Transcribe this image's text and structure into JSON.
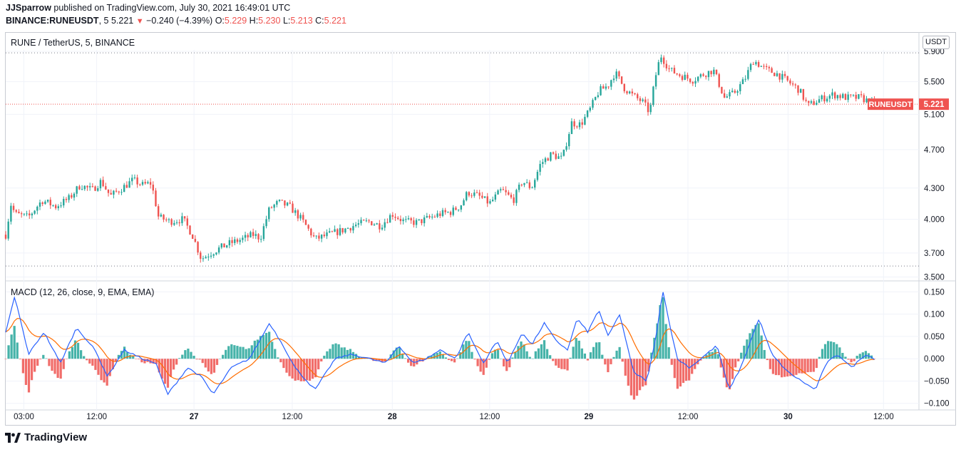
{
  "header": {
    "user": "JJSparrow",
    "published": "published on TradingView.com, July 30, 2021 16:49:01 UTC",
    "symbol": "BINANCE:RUNEUSDT",
    "interval": "5",
    "last": "5.221",
    "change": "−0.240 (−4.39%)",
    "o_label": "O:",
    "o": "5.229",
    "h_label": "H:",
    "h": "5.230",
    "l_label": "L:",
    "l": "5.213",
    "c_label": "C:",
    "c": "5.221"
  },
  "price_pane": {
    "title": "RUNE / TetherUS, 5, BINANCE",
    "currency": "USDT",
    "price_label_symbol": "RUNEUSDT",
    "price_label_value": "5.221"
  },
  "macd_pane": {
    "title": "MACD (12, 26, close, 9, EMA, EMA)"
  },
  "footer": {
    "brand": "TradingView"
  },
  "colors": {
    "up": "#26a69a",
    "down": "#ef5350",
    "macd": "#2962ff",
    "signal": "#ff6d00",
    "price_line": "#ef5350"
  },
  "chart_data": [
    {
      "type": "candlestick",
      "title": "RUNE / TetherUS, 5, BINANCE",
      "y_axis_ticks": [
        "3.500",
        "3.700",
        "4.000",
        "4.300",
        "4.700",
        "5.100",
        "5.500",
        "5.900"
      ],
      "y_axis_scale": "log",
      "ylim": [
        3.48,
        5.92
      ],
      "x_axis_ticks": [
        "03:00",
        "12:00",
        "27",
        "12:00",
        "28",
        "12:00",
        "29",
        "12:00",
        "30",
        "12:00"
      ],
      "last_price": 5.221,
      "dotted_levels": [
        5.88,
        3.59
      ],
      "close_path": [
        {
          "t": 0.0,
          "p": 3.86
        },
        {
          "t": 0.006,
          "p": 4.15
        },
        {
          "t": 0.01,
          "p": 4.05
        },
        {
          "t": 0.025,
          "p": 4.02
        },
        {
          "t": 0.04,
          "p": 4.18
        },
        {
          "t": 0.055,
          "p": 4.12
        },
        {
          "t": 0.07,
          "p": 4.2
        },
        {
          "t": 0.082,
          "p": 4.33
        },
        {
          "t": 0.095,
          "p": 4.28
        },
        {
          "t": 0.105,
          "p": 4.37
        },
        {
          "t": 0.115,
          "p": 4.22
        },
        {
          "t": 0.128,
          "p": 4.3
        },
        {
          "t": 0.14,
          "p": 4.38
        },
        {
          "t": 0.15,
          "p": 4.33
        },
        {
          "t": 0.16,
          "p": 4.35
        },
        {
          "t": 0.168,
          "p": 4.02
        },
        {
          "t": 0.18,
          "p": 3.98
        },
        {
          "t": 0.195,
          "p": 4.0
        },
        {
          "t": 0.205,
          "p": 3.86
        },
        {
          "t": 0.215,
          "p": 3.65
        },
        {
          "t": 0.23,
          "p": 3.72
        },
        {
          "t": 0.245,
          "p": 3.78
        },
        {
          "t": 0.26,
          "p": 3.82
        },
        {
          "t": 0.272,
          "p": 3.86
        },
        {
          "t": 0.28,
          "p": 3.83
        },
        {
          "t": 0.29,
          "p": 4.1
        },
        {
          "t": 0.3,
          "p": 4.16
        },
        {
          "t": 0.312,
          "p": 4.12
        },
        {
          "t": 0.325,
          "p": 4.0
        },
        {
          "t": 0.34,
          "p": 3.82
        },
        {
          "t": 0.355,
          "p": 3.86
        },
        {
          "t": 0.37,
          "p": 3.9
        },
        {
          "t": 0.385,
          "p": 3.95
        },
        {
          "t": 0.4,
          "p": 3.98
        },
        {
          "t": 0.412,
          "p": 3.94
        },
        {
          "t": 0.425,
          "p": 4.05
        },
        {
          "t": 0.438,
          "p": 3.98
        },
        {
          "t": 0.452,
          "p": 3.97
        },
        {
          "t": 0.465,
          "p": 4.01
        },
        {
          "t": 0.478,
          "p": 4.05
        },
        {
          "t": 0.49,
          "p": 4.07
        },
        {
          "t": 0.5,
          "p": 4.13
        },
        {
          "t": 0.508,
          "p": 4.26
        },
        {
          "t": 0.52,
          "p": 4.22
        },
        {
          "t": 0.532,
          "p": 4.15
        },
        {
          "t": 0.545,
          "p": 4.28
        },
        {
          "t": 0.558,
          "p": 4.18
        },
        {
          "t": 0.568,
          "p": 4.37
        },
        {
          "t": 0.578,
          "p": 4.3
        },
        {
          "t": 0.588,
          "p": 4.55
        },
        {
          "t": 0.6,
          "p": 4.65
        },
        {
          "t": 0.612,
          "p": 4.6
        },
        {
          "t": 0.622,
          "p": 5.0
        },
        {
          "t": 0.632,
          "p": 4.98
        },
        {
          "t": 0.642,
          "p": 5.15
        },
        {
          "t": 0.652,
          "p": 5.38
        },
        {
          "t": 0.662,
          "p": 5.45
        },
        {
          "t": 0.67,
          "p": 5.62
        },
        {
          "t": 0.68,
          "p": 5.42
        },
        {
          "t": 0.69,
          "p": 5.32
        },
        {
          "t": 0.7,
          "p": 5.25
        },
        {
          "t": 0.708,
          "p": 5.12
        },
        {
          "t": 0.714,
          "p": 5.55
        },
        {
          "t": 0.72,
          "p": 5.85
        },
        {
          "t": 0.73,
          "p": 5.65
        },
        {
          "t": 0.742,
          "p": 5.58
        },
        {
          "t": 0.755,
          "p": 5.52
        },
        {
          "t": 0.768,
          "p": 5.6
        },
        {
          "t": 0.778,
          "p": 5.65
        },
        {
          "t": 0.79,
          "p": 5.3
        },
        {
          "t": 0.8,
          "p": 5.35
        },
        {
          "t": 0.812,
          "p": 5.52
        },
        {
          "t": 0.822,
          "p": 5.78
        },
        {
          "t": 0.835,
          "p": 5.66
        },
        {
          "t": 0.848,
          "p": 5.6
        },
        {
          "t": 0.86,
          "p": 5.5
        },
        {
          "t": 0.872,
          "p": 5.4
        },
        {
          "t": 0.882,
          "p": 5.2
        },
        {
          "t": 0.895,
          "p": 5.28
        },
        {
          "t": 0.91,
          "p": 5.34
        },
        {
          "t": 0.925,
          "p": 5.3
        },
        {
          "t": 0.94,
          "p": 5.3
        },
        {
          "t": 0.955,
          "p": 5.221
        }
      ]
    },
    {
      "type": "line+histogram",
      "title": "MACD (12, 26, close, 9, EMA, EMA)",
      "y_axis_ticks": [
        "0.150",
        "0.100",
        "0.050",
        "0.000",
        "−0.050",
        "−0.100"
      ],
      "ylim": [
        -0.11,
        0.165
      ],
      "series": [
        {
          "name": "MACD",
          "color": "#2962ff",
          "path": [
            {
              "t": 0.0,
              "v": 0.06
            },
            {
              "t": 0.01,
              "v": 0.14
            },
            {
              "t": 0.025,
              "v": 0.01
            },
            {
              "t": 0.042,
              "v": 0.06
            },
            {
              "t": 0.06,
              "v": -0.01
            },
            {
              "t": 0.078,
              "v": 0.07
            },
            {
              "t": 0.098,
              "v": 0.02
            },
            {
              "t": 0.112,
              "v": -0.04
            },
            {
              "t": 0.13,
              "v": 0.02
            },
            {
              "t": 0.15,
              "v": 0.0
            },
            {
              "t": 0.165,
              "v": -0.01
            },
            {
              "t": 0.178,
              "v": -0.08
            },
            {
              "t": 0.2,
              "v": -0.02
            },
            {
              "t": 0.215,
              "v": -0.04
            },
            {
              "t": 0.228,
              "v": -0.08
            },
            {
              "t": 0.248,
              "v": -0.02
            },
            {
              "t": 0.268,
              "v": 0.0
            },
            {
              "t": 0.29,
              "v": 0.08
            },
            {
              "t": 0.305,
              "v": 0.03
            },
            {
              "t": 0.318,
              "v": -0.02
            },
            {
              "t": 0.34,
              "v": -0.07
            },
            {
              "t": 0.362,
              "v": 0.0
            },
            {
              "t": 0.38,
              "v": 0.01
            },
            {
              "t": 0.4,
              "v": 0.0
            },
            {
              "t": 0.418,
              "v": -0.01
            },
            {
              "t": 0.432,
              "v": 0.03
            },
            {
              "t": 0.448,
              "v": -0.01
            },
            {
              "t": 0.462,
              "v": 0.0
            },
            {
              "t": 0.478,
              "v": 0.02
            },
            {
              "t": 0.495,
              "v": 0.0
            },
            {
              "t": 0.508,
              "v": 0.06
            },
            {
              "t": 0.525,
              "v": -0.01
            },
            {
              "t": 0.54,
              "v": 0.04
            },
            {
              "t": 0.552,
              "v": -0.01
            },
            {
              "t": 0.568,
              "v": 0.06
            },
            {
              "t": 0.578,
              "v": 0.03
            },
            {
              "t": 0.592,
              "v": 0.08
            },
            {
              "t": 0.605,
              "v": 0.04
            },
            {
              "t": 0.618,
              "v": 0.02
            },
            {
              "t": 0.628,
              "v": 0.09
            },
            {
              "t": 0.64,
              "v": 0.06
            },
            {
              "t": 0.652,
              "v": 0.11
            },
            {
              "t": 0.662,
              "v": 0.05
            },
            {
              "t": 0.675,
              "v": 0.1
            },
            {
              "t": 0.69,
              "v": -0.03
            },
            {
              "t": 0.705,
              "v": -0.05
            },
            {
              "t": 0.715,
              "v": 0.05
            },
            {
              "t": 0.722,
              "v": 0.155
            },
            {
              "t": 0.738,
              "v": 0.0
            },
            {
              "t": 0.752,
              "v": -0.02
            },
            {
              "t": 0.77,
              "v": 0.01
            },
            {
              "t": 0.782,
              "v": 0.03
            },
            {
              "t": 0.795,
              "v": -0.07
            },
            {
              "t": 0.808,
              "v": -0.02
            },
            {
              "t": 0.828,
              "v": 0.09
            },
            {
              "t": 0.842,
              "v": 0.01
            },
            {
              "t": 0.86,
              "v": -0.03
            },
            {
              "t": 0.875,
              "v": -0.05
            },
            {
              "t": 0.89,
              "v": -0.07
            },
            {
              "t": 0.902,
              "v": -0.01
            },
            {
              "t": 0.915,
              "v": 0.01
            },
            {
              "t": 0.93,
              "v": -0.02
            },
            {
              "t": 0.945,
              "v": 0.01
            },
            {
              "t": 0.955,
              "v": 0.0
            }
          ]
        },
        {
          "name": "Signal",
          "color": "#ff6d00",
          "lag": 0.008,
          "smooth": 0.55
        }
      ]
    }
  ]
}
